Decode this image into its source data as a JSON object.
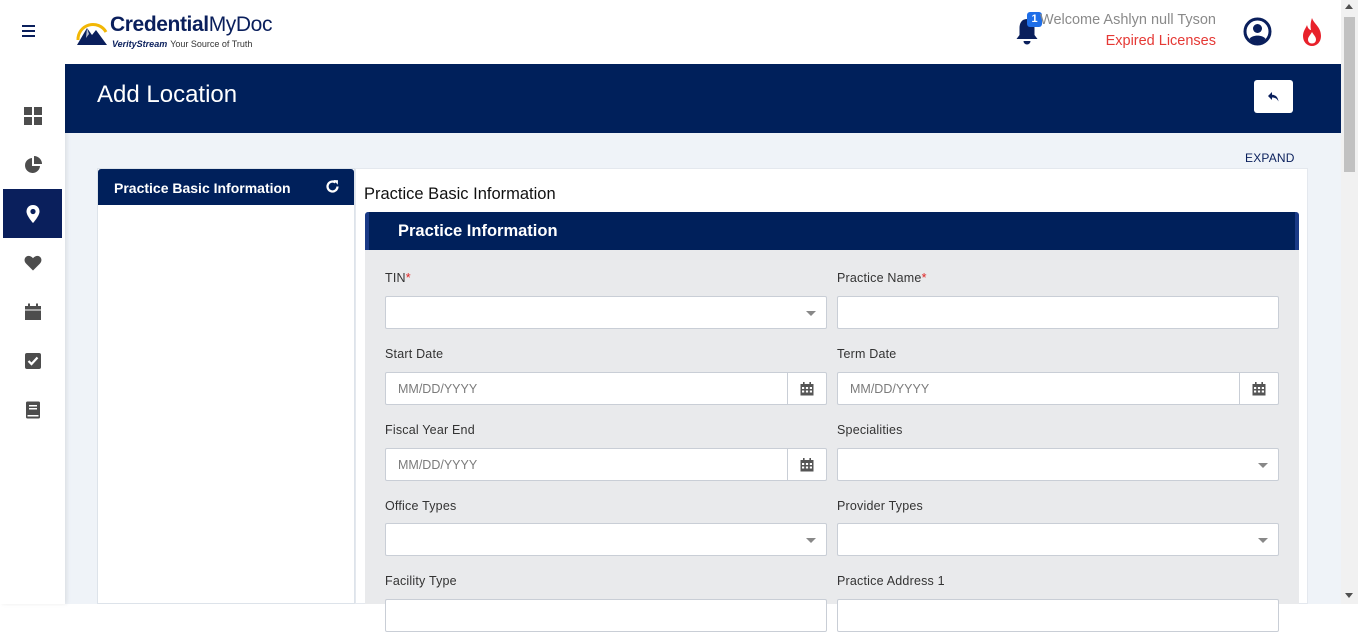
{
  "app": {
    "brand_bold": "Credential",
    "brand_light": "MyDoc",
    "sub_brand": "VerityStream",
    "tagline": "Your Source of Truth"
  },
  "header": {
    "notification_count": "1",
    "welcome": "Welcome Ashlyn null Tyson",
    "expired_link": "Expired Licenses"
  },
  "sidebar": {
    "items": [
      {
        "icon": "dashboard-icon"
      },
      {
        "icon": "pie-chart-icon"
      },
      {
        "icon": "location-pin-icon",
        "active": true
      },
      {
        "icon": "heart-icon"
      },
      {
        "icon": "calendar-icon"
      },
      {
        "icon": "checkbox-icon"
      },
      {
        "icon": "book-icon"
      }
    ]
  },
  "page": {
    "title": "Add Location",
    "expand_label": "EXPAND"
  },
  "left_nav": {
    "tab_label": "Practice Basic Information"
  },
  "main": {
    "section_title": "Practice Basic Information",
    "card_title": "Practice Information",
    "fields": {
      "tin": {
        "label": "TIN",
        "required": "*"
      },
      "practice_name": {
        "label": "Practice Name",
        "required": "*"
      },
      "start_date": {
        "label": "Start Date",
        "placeholder": "MM/DD/YYYY"
      },
      "term_date": {
        "label": "Term Date",
        "placeholder": "MM/DD/YYYY"
      },
      "fiscal_year_end": {
        "label": "Fiscal Year End",
        "placeholder": "MM/DD/YYYY"
      },
      "specialities": {
        "label": "Specialities"
      },
      "office_types": {
        "label": "Office Types"
      },
      "provider_types": {
        "label": "Provider Types"
      },
      "facility_type": {
        "label": "Facility Type"
      },
      "practice_address_1": {
        "label": "Practice Address 1"
      }
    }
  },
  "colors": {
    "navy": "#00205b",
    "danger": "#e53935",
    "badge": "#1e6ee8"
  }
}
